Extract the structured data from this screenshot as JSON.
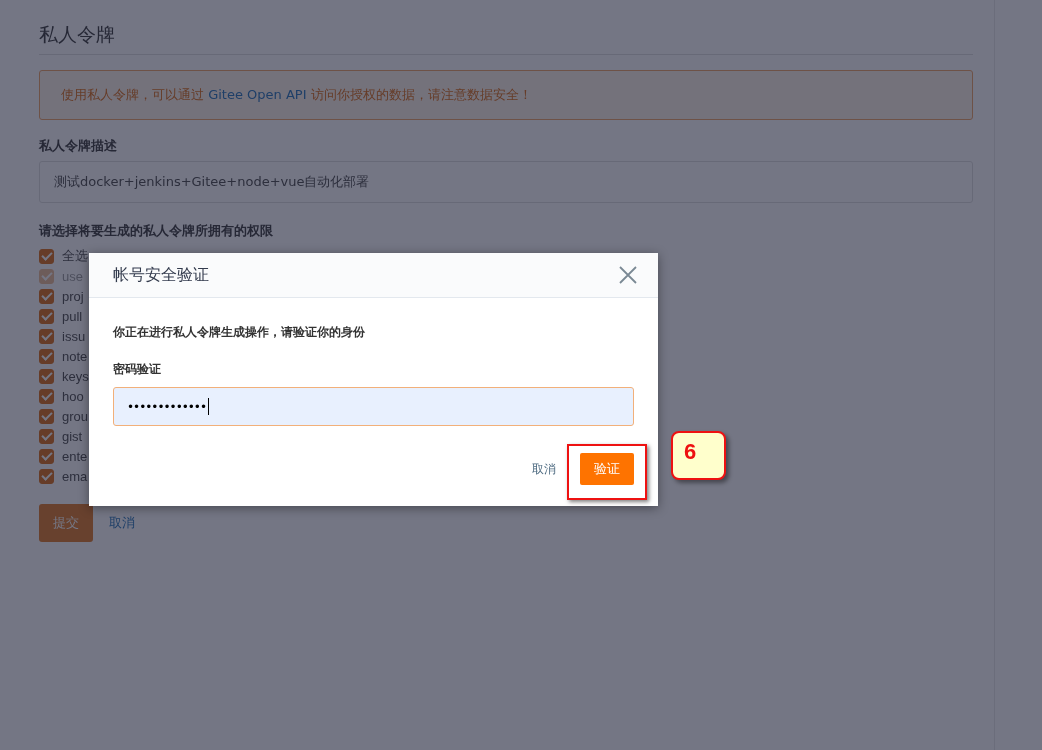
{
  "page": {
    "title": "私人令牌",
    "alert": {
      "text_before": "使用私人令牌，可以通过 ",
      "link": "Gitee Open API",
      "text_after": " 访问你授权的数据，请注意数据安全！"
    },
    "description_label": "私人令牌描述",
    "description_value": "测试docker+jenkins+Gitee+node+vue自动化部署",
    "permissions_label": "请选择将要生成的私人令牌所拥有的权限",
    "permissions": [
      {
        "label": "全选",
        "checked": true,
        "disabled": false
      },
      {
        "label": "use",
        "checked": true,
        "disabled": true
      },
      {
        "label": "proj",
        "checked": true,
        "disabled": false
      },
      {
        "label": "pull",
        "checked": true,
        "disabled": false
      },
      {
        "label": "issu",
        "checked": true,
        "disabled": false
      },
      {
        "label": "note",
        "checked": true,
        "disabled": false
      },
      {
        "label": "keys",
        "checked": true,
        "disabled": false
      },
      {
        "label": "hoo",
        "checked": true,
        "disabled": false
      },
      {
        "label": "grou",
        "checked": true,
        "disabled": false
      },
      {
        "label": "gist",
        "checked": true,
        "disabled": false
      },
      {
        "label": "ente",
        "checked": true,
        "disabled": false
      },
      {
        "label": "ema",
        "checked": true,
        "disabled": false
      }
    ],
    "buttons": [
      "提交",
      "取消"
    ]
  },
  "dialog": {
    "title": "帐号安全验证",
    "message": "你正在进行私人令牌生成操作，请验证你的身份",
    "field_label": "密码验证",
    "password": "•••••••••••••",
    "buttons": [
      "取消",
      "验证"
    ]
  },
  "callout": {
    "label": "6"
  }
}
